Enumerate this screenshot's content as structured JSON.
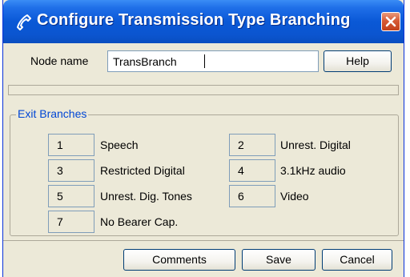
{
  "window": {
    "title": "Configure Transmission Type Branching",
    "colors": {
      "titlebar": "#0a58d6",
      "close": "#d65a35",
      "legend": "#0046d5",
      "face": "#ece9d8"
    }
  },
  "node": {
    "label": "Node name",
    "value": "TransBranch",
    "help_label": "Help"
  },
  "branches": {
    "legend": "Exit Branches",
    "items": [
      {
        "num": "1",
        "label": "Speech"
      },
      {
        "num": "2",
        "label": "Unrest. Digital"
      },
      {
        "num": "3",
        "label": "Restricted Digital"
      },
      {
        "num": "4",
        "label": "3.1kHz audio"
      },
      {
        "num": "5",
        "label": "Unrest. Dig. Tones"
      },
      {
        "num": "6",
        "label": "Video"
      },
      {
        "num": "7",
        "label": "No Bearer Cap."
      }
    ]
  },
  "buttons": {
    "comments": "Comments",
    "save": "Save",
    "cancel": "Cancel"
  }
}
